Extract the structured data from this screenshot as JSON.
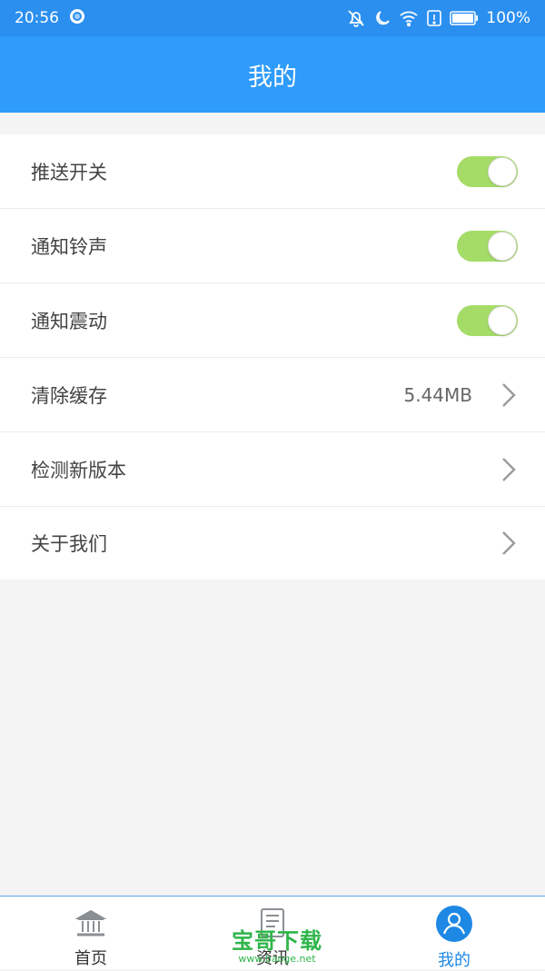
{
  "statusbar": {
    "time": "20:56",
    "battery": "100%"
  },
  "header": {
    "title": "我的"
  },
  "settings": {
    "push_label": "推送开关",
    "ringtone_label": "通知铃声",
    "vibration_label": "通知震动",
    "cache_label": "清除缓存",
    "cache_value": "5.44MB",
    "update_label": "检测新版本",
    "about_label": "关于我们",
    "push_on": true,
    "ringtone_on": true,
    "vibration_on": true
  },
  "tabbar": {
    "home": "首页",
    "news": "资讯",
    "mine": "我的"
  },
  "watermark": {
    "main": "宝哥下载",
    "sub": "www.baoge.net"
  },
  "colors": {
    "accent": "#2f9bfa",
    "toggle_on": "#a5dc68",
    "active_tab": "#1e88e5"
  },
  "icons": [
    "circle-status-icon",
    "bell-off-icon",
    "moon-icon",
    "wifi-icon",
    "alert-icon",
    "battery-icon",
    "bank-icon",
    "document-icon",
    "user-icon",
    "chevron-right-icon"
  ]
}
